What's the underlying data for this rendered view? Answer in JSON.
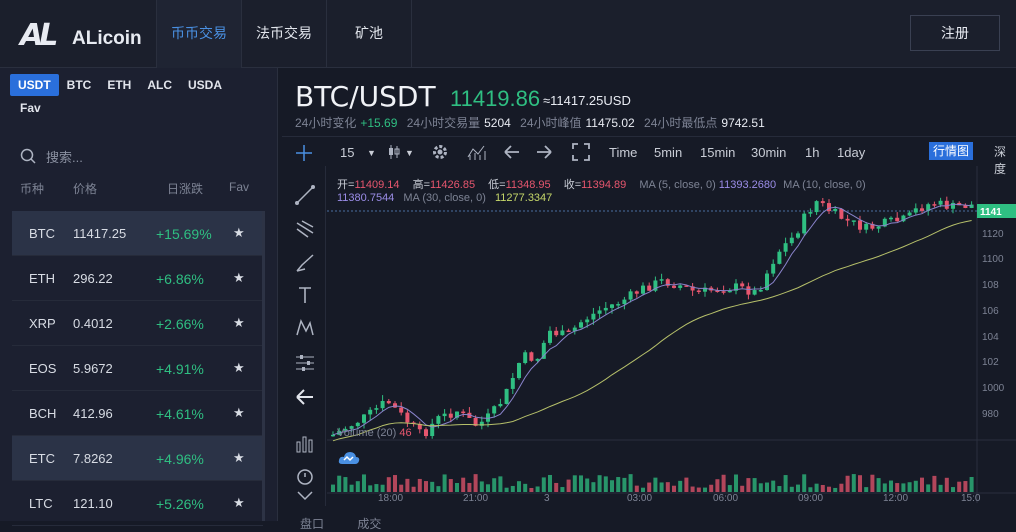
{
  "brand": {
    "logo_mark": "AL",
    "name": "ALicoin"
  },
  "nav": {
    "items": [
      "币币交易",
      "法币交易",
      "矿池"
    ],
    "register": "注册"
  },
  "sidebar": {
    "quote_tabs": [
      "USDT",
      "BTC",
      "ETH",
      "ALC",
      "USDA"
    ],
    "fav_tab": "Fav",
    "search_placeholder": "搜索...",
    "columns": {
      "symbol": "币种",
      "price": "价格",
      "change": "日涨跌",
      "fav": "Fav"
    },
    "rows": [
      {
        "symbol": "BTC",
        "price": "11417.25",
        "change": "+15.69%"
      },
      {
        "symbol": "ETH",
        "price": "296.22",
        "change": "+6.86%"
      },
      {
        "symbol": "XRP",
        "price": "0.4012",
        "change": "+2.66%"
      },
      {
        "symbol": "EOS",
        "price": "5.9672",
        "change": "+4.91%"
      },
      {
        "symbol": "BCH",
        "price": "412.96",
        "change": "+4.61%"
      },
      {
        "symbol": "ETC",
        "price": "7.8262",
        "change": "+4.96%"
      },
      {
        "symbol": "LTC",
        "price": "121.10",
        "change": "+5.26%"
      }
    ]
  },
  "ticker": {
    "pair": "BTC/USDT",
    "last": "11419.86",
    "usd": "≈11417.25USD",
    "change_label": "24小时变化",
    "change": "+15.69",
    "volume_label": "24小时交易量",
    "volume": "5204",
    "high_label": "24小时峰值",
    "high": "11475.02",
    "low_label": "24小时最低点",
    "low": "9742.51"
  },
  "toolbar": {
    "interval": "15",
    "time_label": "Time",
    "intervals": [
      "5min",
      "15min",
      "30min",
      "1h",
      "1day"
    ],
    "chart_tab": "行情图",
    "depth_tab": "深度"
  },
  "legend": {
    "open_label": "开=",
    "open": "11409.14",
    "high_label": "高=",
    "high": "11426.85",
    "low_label": "低=",
    "low": "11348.95",
    "close_label": "收=",
    "close": "11394.89",
    "ma5_label": "MA (5, close, 0)",
    "ma5": "11393.2680",
    "ma10_label": "MA (10, close, 0)",
    "ma10": "11380.7544",
    "ma30_label": "MA (30, close, 0)",
    "ma30": "11277.3347",
    "volume_label": "Volume (20)",
    "volume": "46"
  },
  "chart_data": {
    "type": "candlestick",
    "x_ticks": [
      "18:00",
      "21:00",
      "3",
      "03:00",
      "06:00",
      "09:00",
      "12:00",
      "15:0"
    ],
    "y_ticks": [
      "1141",
      "1120",
      "1100",
      "108",
      "106",
      "104",
      "102",
      "1000",
      "980"
    ],
    "colors": {
      "up": "#2fbf82",
      "down": "#e7566e",
      "ma5": "#9b8de8",
      "ma30": "#c6d86a"
    }
  },
  "bottom_tabs": [
    "盘口",
    "成交"
  ]
}
